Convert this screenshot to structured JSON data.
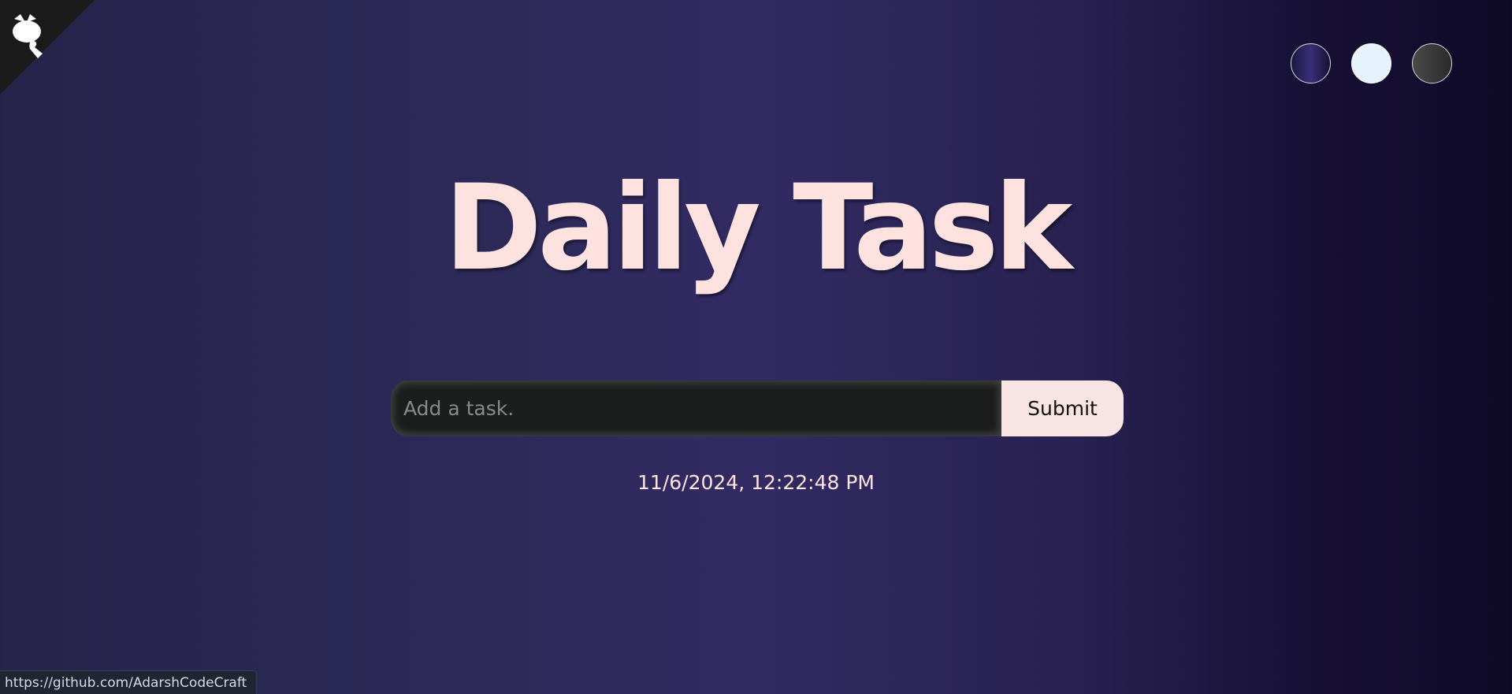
{
  "header": {
    "github_corner_icon": "github-octocat-icon"
  },
  "themes": [
    {
      "name": "standard",
      "color": "#2a2560"
    },
    {
      "name": "light",
      "color": "#e6f3ff"
    },
    {
      "name": "darker",
      "color": "#3a3a3a"
    }
  ],
  "main": {
    "title": "Daily Task",
    "form": {
      "input_placeholder": "Add a task.",
      "input_value": "",
      "submit_label": "Submit"
    },
    "datetime": "11/6/2024, 12:22:48 PM"
  },
  "status_bar": {
    "url": "https://github.com/AdarshCodeCraft"
  },
  "colors": {
    "accent": "#fde2e0",
    "input_bg": "#1c1d1d",
    "button_bg": "#f7e4e3"
  }
}
